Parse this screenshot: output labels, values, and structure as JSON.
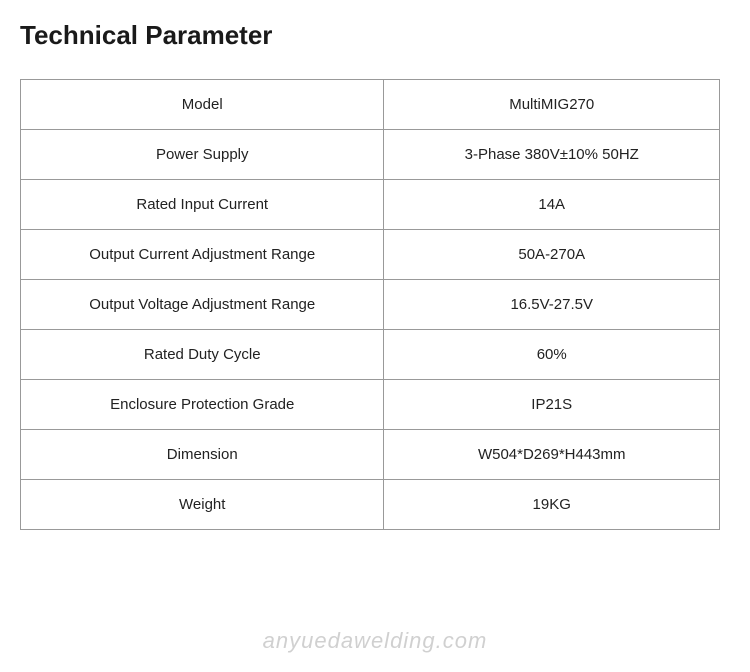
{
  "page": {
    "title": "Technical Parameter"
  },
  "table": {
    "rows": [
      {
        "label": "Model",
        "value": "MultiMIG270"
      },
      {
        "label": "Power Supply",
        "value": "3-Phase    380V±10%    50HZ"
      },
      {
        "label": "Rated Input Current",
        "value": "14A"
      },
      {
        "label": "Output Current Adjustment Range",
        "value": "50A-270A"
      },
      {
        "label": "Output Voltage Adjustment Range",
        "value": "16.5V-27.5V"
      },
      {
        "label": "Rated Duty Cycle",
        "value": "60%"
      },
      {
        "label": "Enclosure Protection Grade",
        "value": "IP21S"
      },
      {
        "label": "Dimension",
        "value": "W504*D269*H443mm"
      },
      {
        "label": "Weight",
        "value": "19KG"
      }
    ]
  },
  "watermark": {
    "text": "anyuedawelding.com"
  }
}
